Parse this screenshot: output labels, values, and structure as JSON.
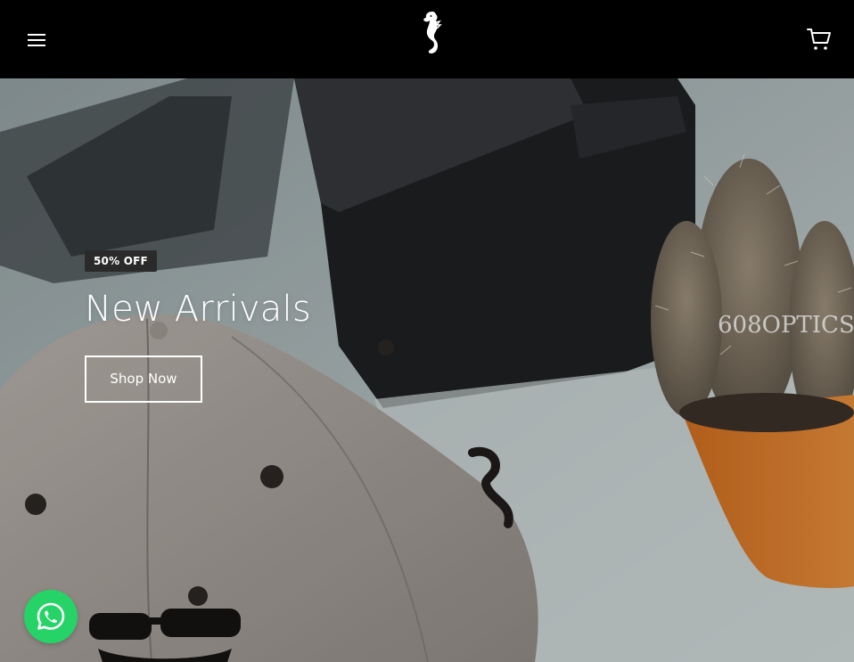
{
  "header": {
    "menu_icon": "hamburger-menu-icon",
    "logo": "seahorse-logo",
    "cart_icon": "shopping-cart-icon"
  },
  "hero": {
    "badge": "50% OFF",
    "title": "New Arrivals",
    "button_label": "Shop Now",
    "watermark_text": "608OPTICS"
  },
  "floating": {
    "whatsapp_icon": "whatsapp-icon"
  },
  "colors": {
    "header_bg": "#000000",
    "badge_bg": "#2a2a2a",
    "whatsapp": "#25d366",
    "text": "#ffffff"
  }
}
